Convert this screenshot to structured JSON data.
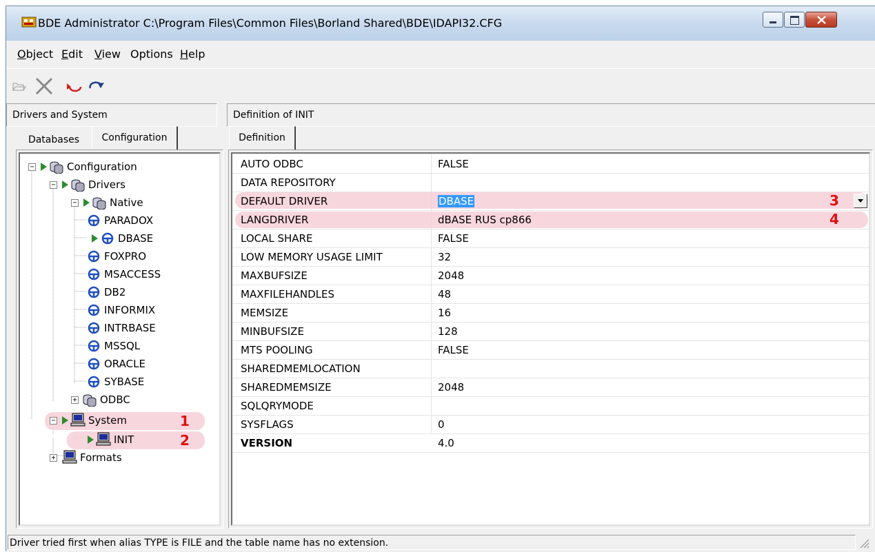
{
  "window": {
    "title": "BDE Administrator  C:\\Program Files\\Common Files\\Borland Shared\\BDE\\IDAPI32.CFG"
  },
  "menu": {
    "items": [
      {
        "u": "O",
        "rest": "bject"
      },
      {
        "u": "E",
        "rest": "dit"
      },
      {
        "u": "V",
        "rest": "iew"
      },
      {
        "u": "",
        "rest": "Options"
      },
      {
        "u": "H",
        "rest": "elp"
      }
    ]
  },
  "left_pane": {
    "header": "Drivers and System",
    "tabs": [
      "Databases",
      "Configuration"
    ],
    "tree": [
      {
        "label": "Configuration",
        "icon": "database-icon"
      },
      {
        "label": "Drivers",
        "icon": "database-icon"
      },
      {
        "label": "Native",
        "icon": "database-icon"
      },
      {
        "label": "PARADOX",
        "icon": "driver-icon"
      },
      {
        "label": "DBASE",
        "icon": "driver-icon"
      },
      {
        "label": "FOXPRO",
        "icon": "driver-icon"
      },
      {
        "label": "MSACCESS",
        "icon": "driver-icon"
      },
      {
        "label": "DB2",
        "icon": "driver-icon"
      },
      {
        "label": "INFORMIX",
        "icon": "driver-icon"
      },
      {
        "label": "INTRBASE",
        "icon": "driver-icon"
      },
      {
        "label": "MSSQL",
        "icon": "driver-icon"
      },
      {
        "label": "ORACLE",
        "icon": "driver-icon"
      },
      {
        "label": "SYBASE",
        "icon": "driver-icon"
      },
      {
        "label": "ODBC",
        "icon": "database-icon"
      },
      {
        "label": "System",
        "icon": "computer-icon"
      },
      {
        "label": "INIT",
        "icon": "computer-icon"
      },
      {
        "label": "Formats",
        "icon": "computer-icon"
      }
    ]
  },
  "right_pane": {
    "header": "Definition of INIT",
    "tab": "Definition",
    "rows": [
      {
        "key": "AUTO ODBC",
        "value": "FALSE"
      },
      {
        "key": "DATA REPOSITORY",
        "value": ""
      },
      {
        "key": "DEFAULT DRIVER",
        "value": "DBASE"
      },
      {
        "key": "LANGDRIVER",
        "value": "dBASE RUS cp866"
      },
      {
        "key": "LOCAL SHARE",
        "value": "FALSE"
      },
      {
        "key": "LOW MEMORY USAGE LIMIT",
        "value": "32"
      },
      {
        "key": "MAXBUFSIZE",
        "value": "2048"
      },
      {
        "key": "MAXFILEHANDLES",
        "value": "48"
      },
      {
        "key": "MEMSIZE",
        "value": "16"
      },
      {
        "key": "MINBUFSIZE",
        "value": "128"
      },
      {
        "key": "MTS POOLING",
        "value": "FALSE"
      },
      {
        "key": "SHAREDMEMLOCATION",
        "value": ""
      },
      {
        "key": "SHAREDMEMSIZE",
        "value": "2048"
      },
      {
        "key": "SQLQRYMODE",
        "value": ""
      },
      {
        "key": "SYSFLAGS",
        "value": "0"
      },
      {
        "key": "VERSION",
        "value": "4.0"
      }
    ]
  },
  "annotations": [
    "1",
    "2",
    "3",
    "4"
  ],
  "status": "Driver tried first when alias TYPE is FILE and the table name has no extension.",
  "colors": {
    "highlight": "#f7cfd8",
    "annotation": "#e01010",
    "selection": "#3399ff",
    "arrow": "#2e8b2e"
  }
}
